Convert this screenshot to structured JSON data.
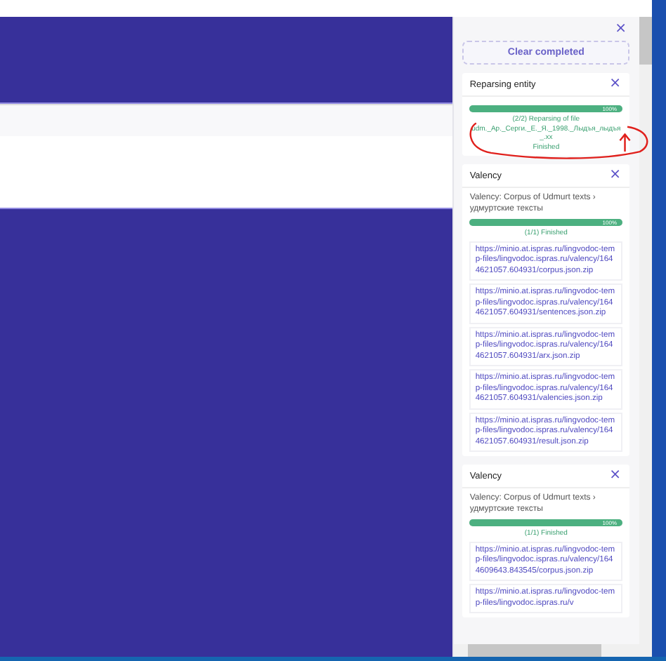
{
  "panel": {
    "close": "×",
    "clear_button": "Clear completed",
    "tasks": [
      {
        "title": "Reparsing entity",
        "close": "×",
        "level": 1,
        "progress_label": "100%",
        "status": [
          "(2/2) Reparsing of file",
          "udm._Ар._Серги._Е._Я._1998._Лыдъя_лыдъя_.xx",
          "Finished"
        ]
      },
      {
        "title": "Valency",
        "close": "×",
        "description": "Valency: Corpus of Udmurt texts › удмуртские тексты",
        "level": 1,
        "progress_label": "100%",
        "status": [
          "(1/1) Finished"
        ],
        "links": [
          "https://minio.at.ispras.ru/lingvodoc-temp-files/lingvodoc.ispras.ru/valency/1644621057.604931/corpus.json.zip",
          "https://minio.at.ispras.ru/lingvodoc-temp-files/lingvodoc.ispras.ru/valency/1644621057.604931/sentences.json.zip",
          "https://minio.at.ispras.ru/lingvodoc-temp-files/lingvodoc.ispras.ru/valency/1644621057.604931/arx.json.zip",
          "https://minio.at.ispras.ru/lingvodoc-temp-files/lingvodoc.ispras.ru/valency/1644621057.604931/valencies.json.zip",
          "https://minio.at.ispras.ru/lingvodoc-temp-files/lingvodoc.ispras.ru/valency/1644621057.604931/result.json.zip"
        ]
      },
      {
        "title": "Valency",
        "close": "×",
        "description": "Valency: Corpus of Udmurt texts › удмуртские тексты",
        "level": 1,
        "progress_label": "100%",
        "status": [
          "(1/1) Finished"
        ],
        "links": [
          "https://minio.at.ispras.ru/lingvodoc-temp-files/lingvodoc.ispras.ru/valency/1644609643.843545/corpus.json.zip",
          "https://minio.at.ispras.ru/lingvodoc-temp-files/lingvodoc.ispras.ru/v"
        ]
      }
    ]
  }
}
